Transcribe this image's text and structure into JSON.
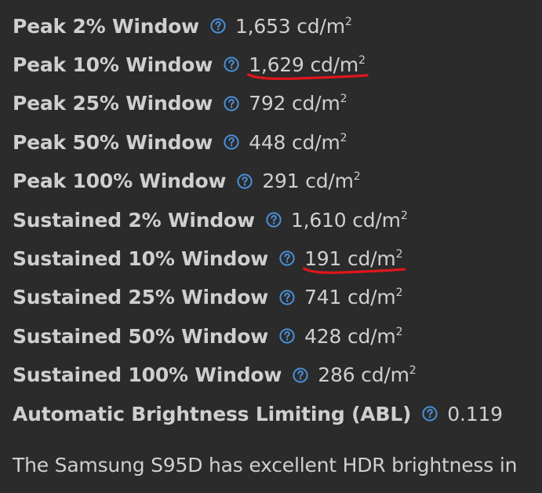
{
  "metrics": [
    {
      "label": "Peak 2% Window",
      "value": "1,653 cd/m",
      "unit_sup": "2",
      "highlighted": false
    },
    {
      "label": "Peak 10% Window",
      "value": "1,629 cd/m",
      "unit_sup": "2",
      "highlighted": true
    },
    {
      "label": "Peak 25% Window",
      "value": "792 cd/m",
      "unit_sup": "2",
      "highlighted": false
    },
    {
      "label": "Peak 50% Window",
      "value": "448 cd/m",
      "unit_sup": "2",
      "highlighted": false
    },
    {
      "label": "Peak 100% Window",
      "value": "291 cd/m",
      "unit_sup": "2",
      "highlighted": false
    },
    {
      "label": "Sustained 2% Window",
      "value": "1,610 cd/m",
      "unit_sup": "2",
      "highlighted": false
    },
    {
      "label": "Sustained 10% Window",
      "value": "191 cd/m",
      "unit_sup": "2",
      "highlighted": true
    },
    {
      "label": "Sustained 25% Window",
      "value": "741 cd/m",
      "unit_sup": "2",
      "highlighted": false
    },
    {
      "label": "Sustained 50% Window",
      "value": "428 cd/m",
      "unit_sup": "2",
      "highlighted": false
    },
    {
      "label": "Sustained 100% Window",
      "value": "286 cd/m",
      "unit_sup": "2",
      "highlighted": false
    },
    {
      "label": "Automatic Brightness Limiting (ABL)",
      "value": "0.119",
      "unit_sup": "",
      "highlighted": false
    }
  ],
  "paragraph": "The Samsung S95D has excellent HDR brightness in",
  "colors": {
    "background": "#2b2b2b",
    "text": "#cfcfcf",
    "help_icon": "#4a90d9",
    "annotation": "#e0161b"
  },
  "icons": {
    "help": "question-circle-icon",
    "annotation": "red-underline-mark"
  }
}
